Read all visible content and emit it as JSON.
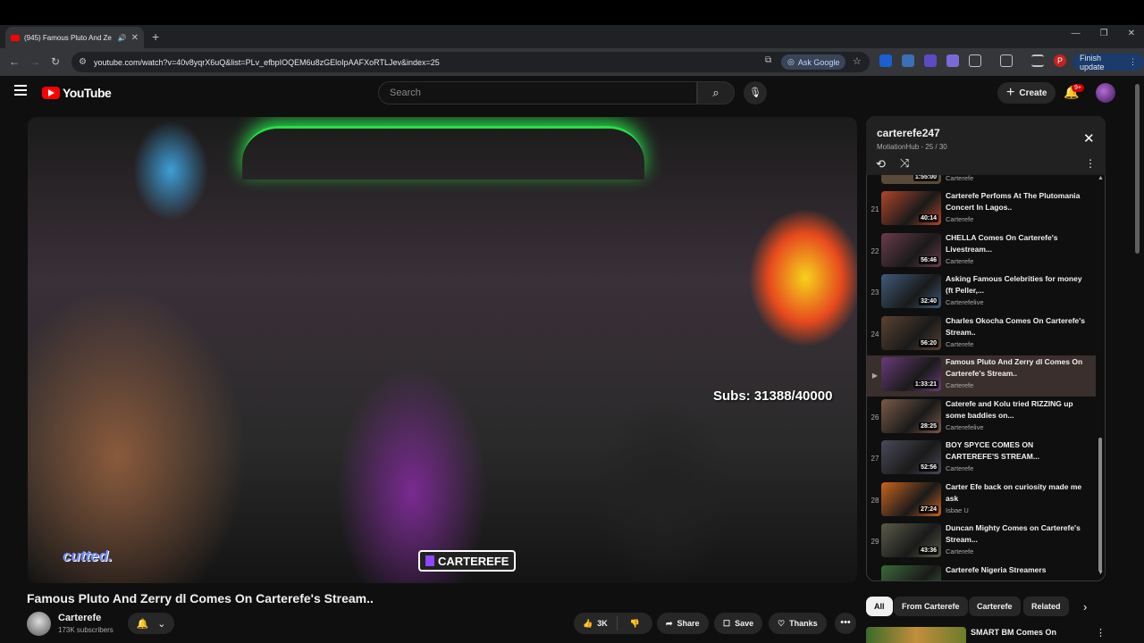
{
  "browser": {
    "tab_title": "(945) Famous Pluto And Ze",
    "new_tab": "+",
    "url": "youtube.com/watch?v=40v8yqrX6uQ&list=PLv_efbpIOQEM6u8zGEloIpAAFXoRTLJev&index=25",
    "ask_google": "Ask Google",
    "finish_update": "Finish update",
    "window_controls": [
      "—",
      "❐",
      "✕"
    ]
  },
  "youtube": {
    "logo_text": "YouTube",
    "search_placeholder": "Search",
    "create_label": "Create",
    "notif_badge": "9+"
  },
  "video": {
    "overlay_subs": "Subs: 31388/40000",
    "overlay_twitch": "CARTEREFE",
    "overlay_logo": "cutted.",
    "title": "Famous Pluto And Zerry dl Comes On Carterefe's Stream..",
    "channel": "Carterefe",
    "subscribers": "173K subscribers",
    "likes": "3K",
    "share_label": "Share",
    "save_label": "Save",
    "thanks_label": "Thanks"
  },
  "playlist": {
    "title": "carterefe247",
    "subtitle": "MotiationHub - 25 / 30",
    "partial_top": {
      "duration": "1:55:00",
      "channel": "Carterefe"
    },
    "items": [
      {
        "num": "21",
        "title": "Carterefe Perfoms At The Plutomania Concert In Lagos..",
        "channel": "Carterefe",
        "duration": "40:14",
        "color": "#b0462a"
      },
      {
        "num": "22",
        "title": "CHELLA Comes On Carterefe's Livestream...",
        "channel": "Carterefe",
        "duration": "56:46",
        "color": "#6a3b4a"
      },
      {
        "num": "23",
        "title": "Asking Famous Celebrities for money (ft Peller,...",
        "channel": "Carterefelive",
        "duration": "32:40",
        "color": "#3e5a7a"
      },
      {
        "num": "24",
        "title": "Charles Okocha Comes On Carterefe's Stream..",
        "channel": "Carterefe",
        "duration": "56:20",
        "color": "#5a4232"
      },
      {
        "num": "▶",
        "title": "Famous Pluto And Zerry dl Comes On Carterefe's Stream..",
        "channel": "Carterefe",
        "duration": "1:33:21",
        "color": "#6a3a7a",
        "active": true
      },
      {
        "num": "26",
        "title": "Caterefe and Kolu tried RIZZING up some baddies on...",
        "channel": "Carterefelive",
        "duration": "28:25",
        "color": "#7a5a48"
      },
      {
        "num": "27",
        "title": "BOY SPYCE COMES ON CARTEREFE'S STREAM...",
        "channel": "Carterefe",
        "duration": "52:56",
        "color": "#4a4a5a"
      },
      {
        "num": "28",
        "title": "Carter Efe back on curiosity made me ask",
        "channel": "Isbae U",
        "duration": "27:24",
        "color": "#c8641e"
      },
      {
        "num": "29",
        "title": "Duncan Mighty Comes on Carterefe's Stream...",
        "channel": "Carterefe",
        "duration": "43:36",
        "color": "#5a5a4a"
      },
      {
        "num": "",
        "title": "Carterefe Nigeria Streamers",
        "channel": "",
        "duration": "",
        "color": "#3a6a3a"
      }
    ]
  },
  "chips": [
    "All",
    "From Carterefe",
    "Carterefe",
    "Related"
  ],
  "recommendation": {
    "title": "SMART BM Comes On"
  }
}
